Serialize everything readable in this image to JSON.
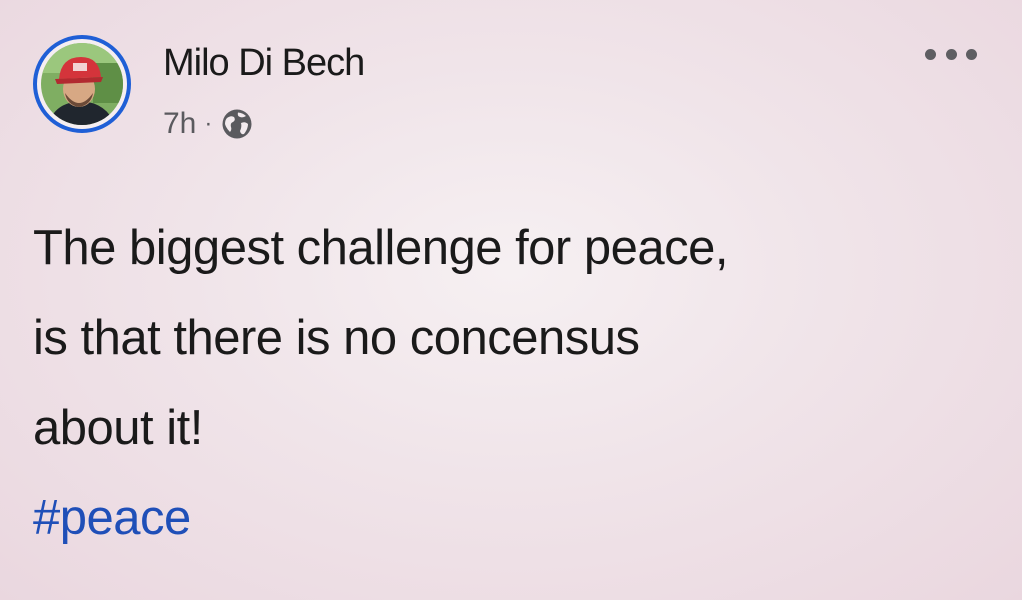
{
  "post": {
    "author": "Milo Di Bech",
    "time": "7h",
    "separator": "·",
    "audience_icon": "globe-icon",
    "more_icon": "more-options-icon",
    "text_lines": [
      "The biggest challenge for peace,",
      "is that there is no concensus",
      "about it!"
    ],
    "hashtag": "#peace"
  },
  "colors": {
    "avatar_ring": "#1f5fd6",
    "hashtag": "#1f4fb8",
    "text": "#1a1a1a",
    "meta": "#5a5a5e"
  }
}
